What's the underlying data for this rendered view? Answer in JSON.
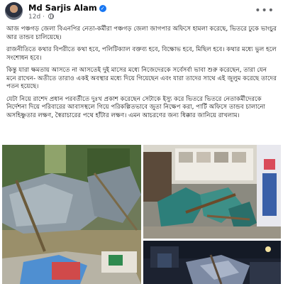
{
  "post": {
    "author": "Md Sarjis Alam",
    "time": "12d",
    "paragraphs": [
      "আজ পঞ্চগড় জেলা বিএনপির নেতা-কর্মীরা পঞ্চগড় জেলা জাগপার অফিসে হামলা করেছে, ভিতরে ঢুকে ভাংচুর আর তান্ডব চালিয়েছে।",
      "রাজনীতিতে কথার বিপরীতে কথা হবে, পলিটিক্যাল বক্তব্য হবে, বিক্ষোভ হবে, মিছিল হবে। কথার মধ্যে ভুল হলে সংশোধন হবে।",
      "কিন্তু যারা ক্ষমতায় আসতে না আসতেই দুই মাসের মধ্যে নিজেদেরকে সর্বেসর্বা ভাবা শুরু করেছেন, তারা যেন মনে রাখেন- অতীতে তারাও একই অবস্থার মধ্যে দিয়ে গিয়েছেন এবং যারা তাদের সাথে এই জুলুম করেছে তাদের পতন হয়েছে।",
      "যেটা নিয়ে রাশেদ প্রধান পরবর্তীতে দুঃখ প্রকাশ করেছেন সেটাকে ইস্যু করে ভিতরে ভিতরে নেতাকর্মীদেরকে নির্দেশনা দিয়ে পরিবারের আবাসস্থলে গিয়ে পরিকল্পিতভাবে জুতা নিক্ষেপ করা, পার্টি অফিসে তান্ডব চালানো অসহিষ্ণুতার লক্ষণ, স্বৈরাচারের পথে হাঁটার লক্ষণ। এমন আচরণের জন্য ধিক্কার জানিয়ে রাখলাম।"
    ]
  },
  "colors": {
    "verified_badge": "#1877f2",
    "meta_text": "#65676b",
    "body_text": "#050505"
  },
  "icons": {
    "verified": "verified-check-icon",
    "audience": "globe-icon",
    "menu": "more-options-icon"
  }
}
